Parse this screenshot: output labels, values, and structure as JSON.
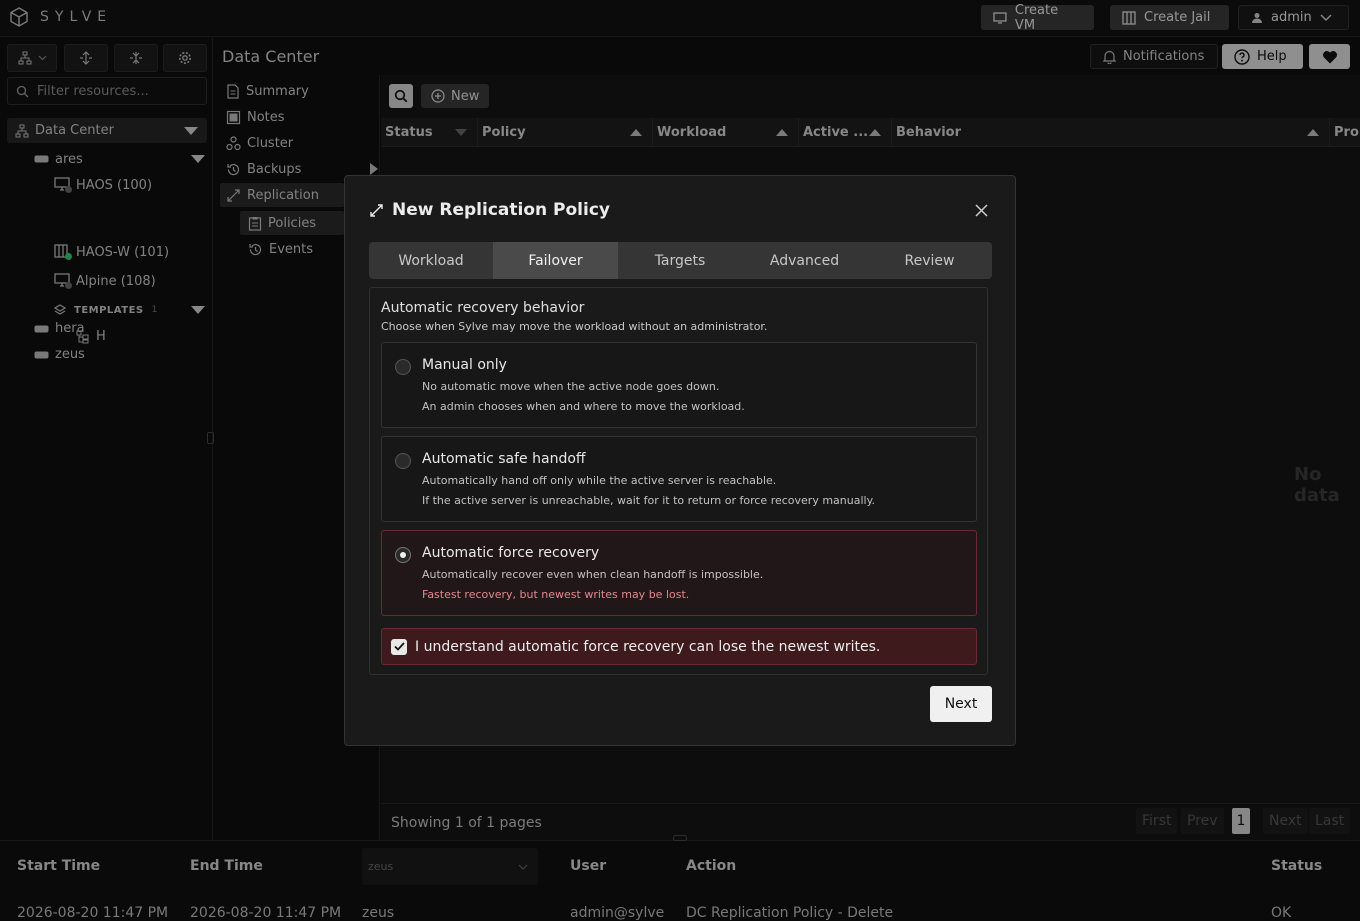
{
  "app": {
    "name": "SYLVE"
  },
  "topbar": {
    "create_vm": "Create VM",
    "create_jail": "Create Jail",
    "user": "admin"
  },
  "sidebar": {
    "filter_placeholder": "Filter resources...",
    "tree": {
      "root": "Data Center",
      "nodes": [
        {
          "label": "ares",
          "children": [
            {
              "label": "HAOS (100)",
              "status": "stopped"
            },
            {
              "label": "HAOS-W (101)",
              "status": "running"
            },
            {
              "label": "Alpine (108)",
              "status": "stopped"
            },
            {
              "label": "TEMPLATES",
              "count": "1",
              "children": [
                {
                  "label": "H"
                }
              ]
            }
          ]
        },
        {
          "label": "hera"
        },
        {
          "label": "zeus"
        }
      ]
    }
  },
  "header": {
    "title": "Data Center",
    "notifications": "Notifications",
    "help": "Help"
  },
  "subnav": {
    "items": [
      "Summary",
      "Notes",
      "Cluster",
      "Backups",
      "Replication"
    ],
    "sub_items": [
      "Policies",
      "Events"
    ]
  },
  "table": {
    "new_label": "New",
    "columns": [
      "Status",
      "Policy",
      "Workload",
      "Active ...",
      "Behavior",
      "Pro"
    ],
    "empty": "No data",
    "pager": {
      "info": "Showing 1 of 1 pages",
      "first": "First",
      "prev": "Prev",
      "page": "1",
      "next": "Next",
      "last": "Last"
    }
  },
  "tasks": {
    "columns": [
      "Start Time",
      "End Time",
      "User",
      "Action",
      "Status"
    ],
    "node_filter": "zeus",
    "row": {
      "start": "2026-08-20 11:47 PM",
      "end": "2026-08-20 11:47 PM",
      "node": "zeus",
      "user": "admin@sylve",
      "action": "DC Replication Policy - Delete",
      "status": "OK"
    }
  },
  "modal": {
    "title": "New Replication Policy",
    "tabs": [
      "Workload",
      "Failover",
      "Targets",
      "Advanced",
      "Review"
    ],
    "active_tab": "Failover",
    "section_heading": "Automatic recovery behavior",
    "section_desc": "Choose when Sylve may move the workload without an administrator.",
    "options": [
      {
        "title": "Manual only",
        "line1": "No automatic move when the active node goes down.",
        "line2": "An admin chooses when and where to move the workload.",
        "selected": false
      },
      {
        "title": "Automatic safe handoff",
        "line1": "Automatically hand off only while the active server is reachable.",
        "line2": "If the active server is unreachable, wait for it to return or force recovery manually.",
        "selected": false
      },
      {
        "title": "Automatic force recovery",
        "line1": "Automatically recover even when clean handoff is impossible.",
        "line2": "Fastest recovery, but newest writes may be lost.",
        "selected": true
      }
    ],
    "acknowledge": "I understand automatic force recovery can lose the newest writes.",
    "acknowledged": true,
    "next": "Next"
  },
  "colors": {
    "warning_text": "#e08a8f",
    "danger_bg": "#3e1a1d",
    "running": "#2ecc71"
  }
}
